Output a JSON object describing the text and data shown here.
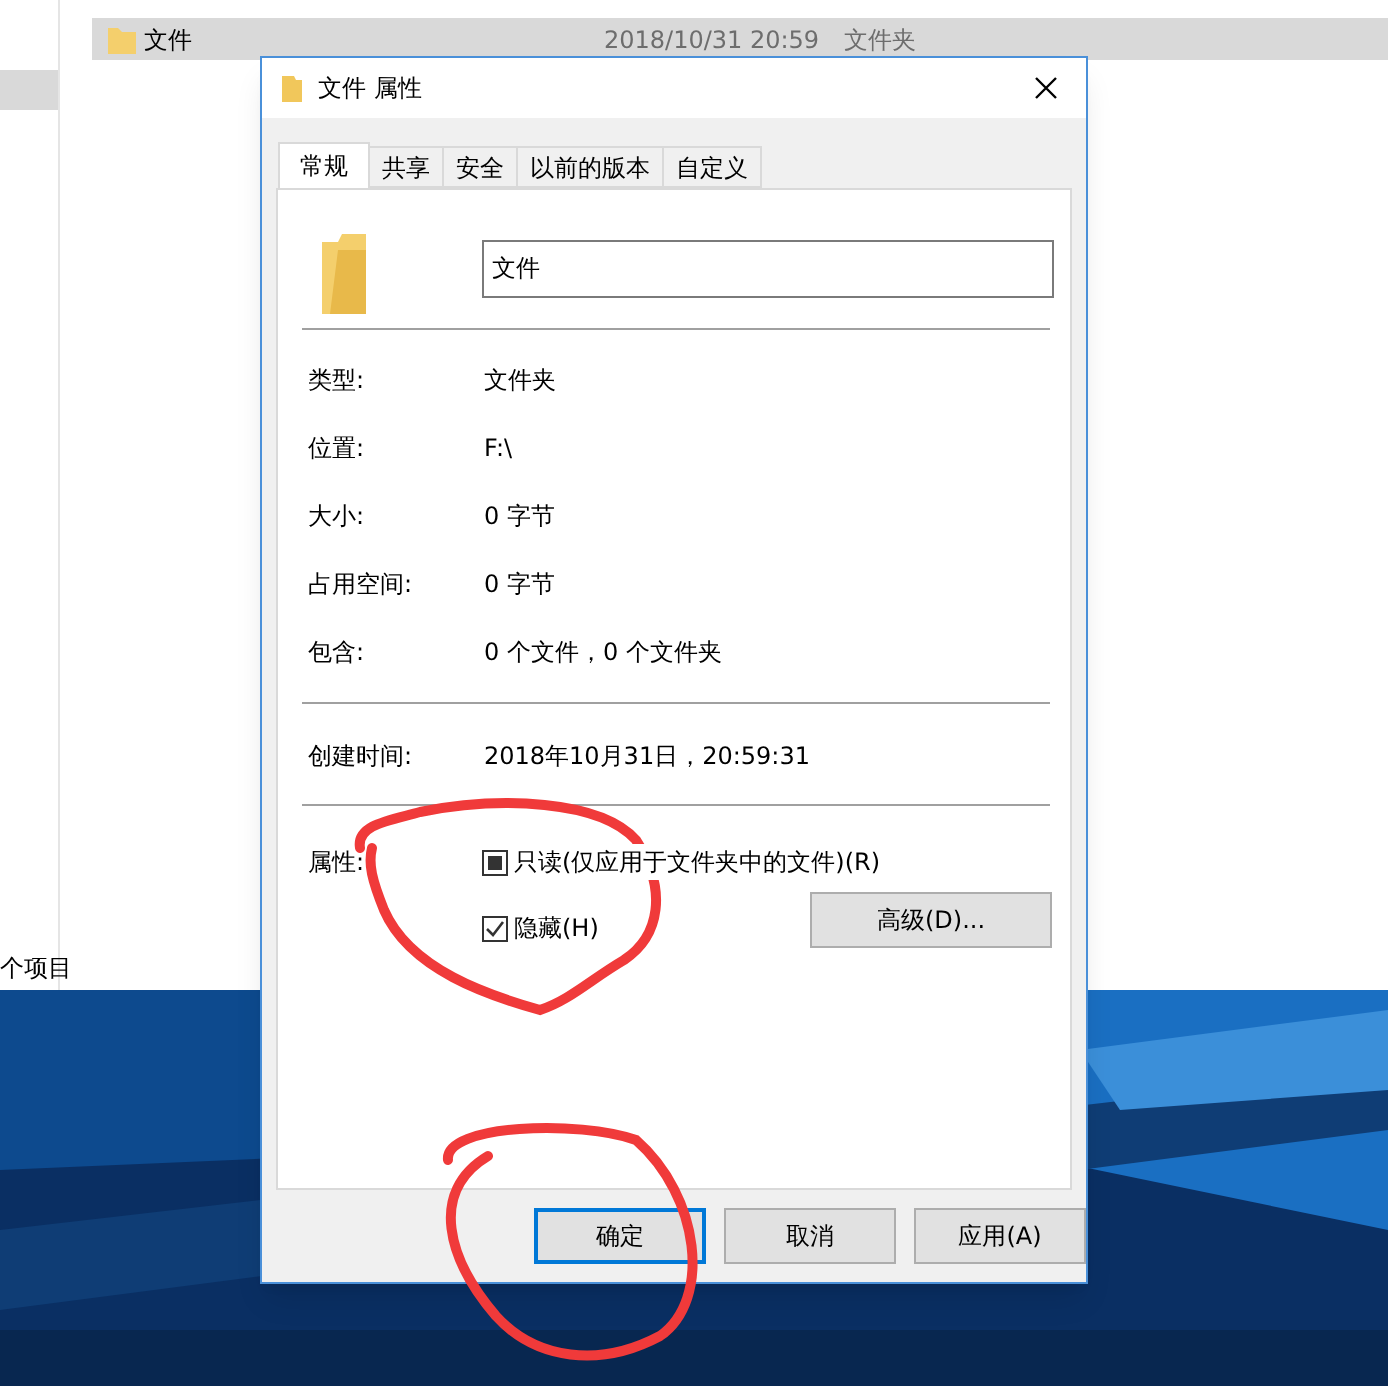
{
  "explorer": {
    "selected_row": {
      "name": "文件",
      "date": "2018/10/31 20:59",
      "type": "文件夹"
    },
    "status_bar": "个项目"
  },
  "window": {
    "title": "文件 属性"
  },
  "tabs": [
    {
      "label": "常规",
      "selected": true
    },
    {
      "label": "共享",
      "selected": false
    },
    {
      "label": "安全",
      "selected": false
    },
    {
      "label": "以前的版本",
      "selected": false
    },
    {
      "label": "自定义",
      "selected": false
    }
  ],
  "name_field": {
    "value": "文件"
  },
  "details": [
    {
      "label": "类型:",
      "value": "文件夹"
    },
    {
      "label": "位置:",
      "value": "F:\\"
    },
    {
      "label": "大小:",
      "value": "0 字节"
    },
    {
      "label": "占用空间:",
      "value": "0 字节"
    },
    {
      "label": "包含:",
      "value": "0 个文件，0 个文件夹"
    }
  ],
  "created": {
    "label": "创建时间:",
    "value": "2018年10月31日，20:59:31"
  },
  "attributes": {
    "label": "属性:",
    "options": [
      {
        "label": "只读(仅应用于文件夹中的文件)(R)",
        "checked": true,
        "mixed": true
      },
      {
        "label": "隐藏(H)",
        "checked": true,
        "mixed": false
      }
    ],
    "advanced_button": "高级(D)..."
  },
  "buttons": [
    {
      "label": "确定",
      "default": true
    },
    {
      "label": "取消",
      "default": false
    },
    {
      "label": "应用(A)",
      "default": false
    }
  ]
}
